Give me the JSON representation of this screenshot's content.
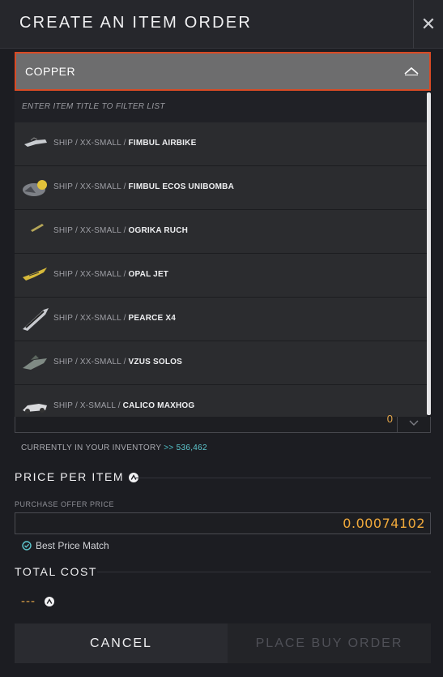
{
  "header": {
    "title": "CREATE AN ITEM ORDER",
    "close_icon": "close-icon"
  },
  "select": {
    "value": "COPPER",
    "chevron_icon": "chevron-up-icon"
  },
  "dropdown": {
    "filter_placeholder": "ENTER ITEM TITLE TO FILTER LIST",
    "items": [
      {
        "category": "SHIP",
        "size": "XX-SMALL",
        "name": "FIMBUL AIRBIKE",
        "icon": "airbike-thumbnail"
      },
      {
        "category": "SHIP",
        "size": "XX-SMALL",
        "name": "FIMBUL ECOS UNIBOMBA",
        "icon": "unibomba-thumbnail"
      },
      {
        "category": "SHIP",
        "size": "XX-SMALL",
        "name": "OGRIKA RUCH",
        "icon": "ruch-thumbnail"
      },
      {
        "category": "SHIP",
        "size": "XX-SMALL",
        "name": "OPAL JET",
        "icon": "opal-jet-thumbnail"
      },
      {
        "category": "SHIP",
        "size": "XX-SMALL",
        "name": "PEARCE X4",
        "icon": "pearce-x4-thumbnail"
      },
      {
        "category": "SHIP",
        "size": "XX-SMALL",
        "name": "VZUS SOLOS",
        "icon": "vzus-solos-thumbnail"
      },
      {
        "category": "SHIP",
        "size": "X-SMALL",
        "name": "CALICO MAXHOG",
        "icon": "maxhog-thumbnail"
      }
    ]
  },
  "quantity": {
    "value": "0"
  },
  "inventory": {
    "label": "CURRENTLY IN YOUR INVENTORY",
    "arrow": ">>",
    "value": "536,462"
  },
  "price": {
    "section_title": "PRICE PER ITEM",
    "field_label": "PURCHASE OFFER PRICE",
    "value": "0.00074102",
    "checkbox_label": "Best Price Match",
    "checkbox_checked": true
  },
  "total": {
    "section_title": "TOTAL COST",
    "value": "---"
  },
  "buttons": {
    "cancel": "CANCEL",
    "place_order": "PLACE BUY ORDER"
  },
  "colors": {
    "accent_border": "#d94a24",
    "price": "#f0a93b",
    "inventory": "#5ec8cf"
  }
}
